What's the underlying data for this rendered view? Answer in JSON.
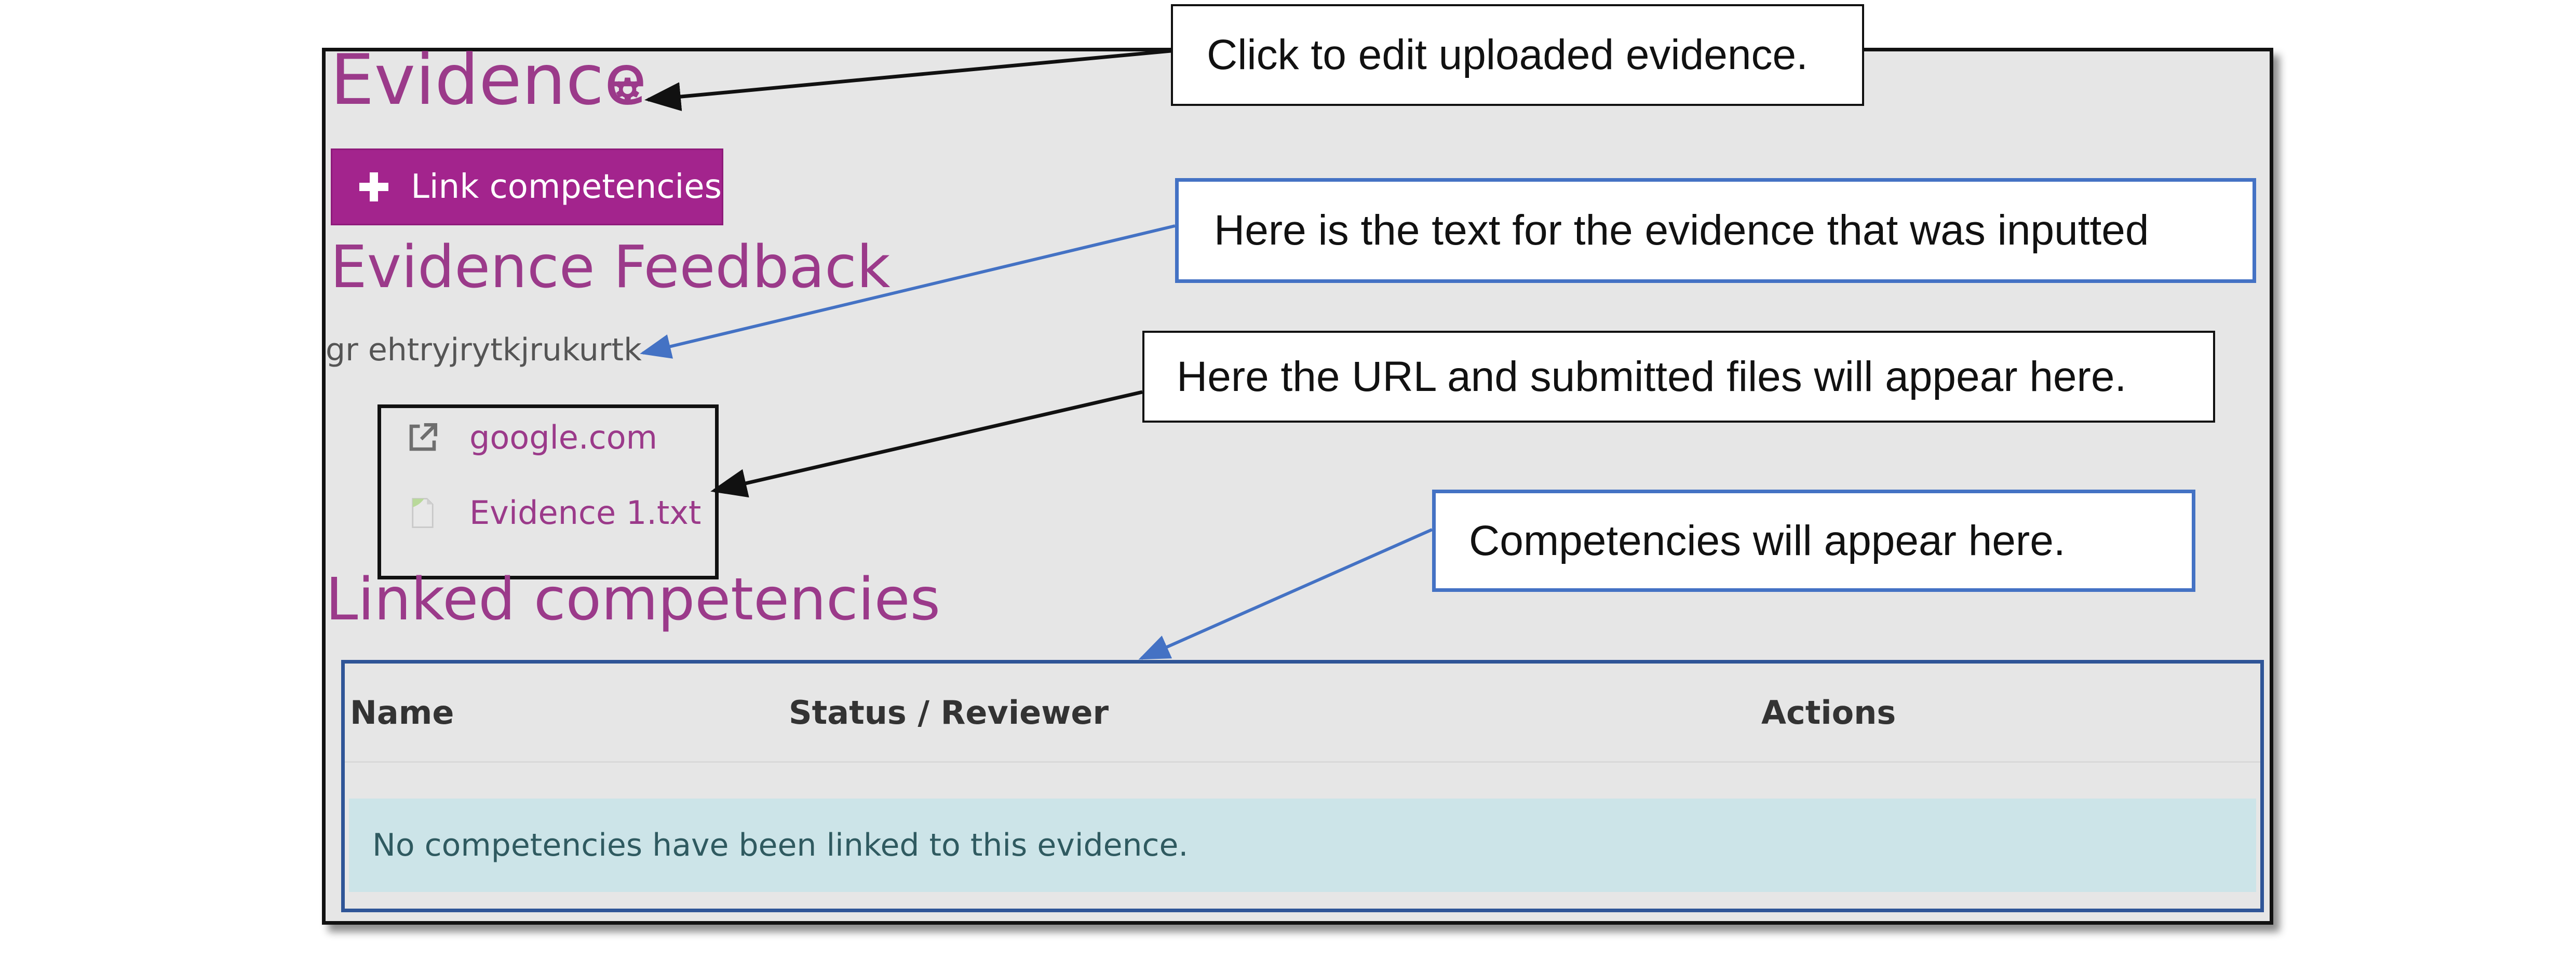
{
  "page": {
    "title": "Evidence",
    "link_button_label": "Link competencies",
    "feedback_title": "Evidence Feedback",
    "feedback_text": "gr ehtryjrytkjrukurtk",
    "files": [
      {
        "label": "google.com",
        "icon": "external-link-icon"
      },
      {
        "label": "Evidence 1.txt",
        "icon": "text-file-icon"
      }
    ],
    "linked_title": "Linked competencies",
    "table": {
      "headers": [
        "Name",
        "Status / Reviewer",
        "Actions"
      ],
      "empty_message": "No competencies have been linked to this evidence."
    }
  },
  "callouts": {
    "edit": "Click to edit uploaded evidence.",
    "text": "Here is the text for the evidence that was inputted",
    "files": "Here the URL and submitted files will appear here.",
    "competencies": "Competencies will appear here."
  },
  "colors": {
    "accent": "#9b3a8a",
    "button": "#a3248d",
    "panel_bg": "#e6e6e6",
    "info_row": "#cce4e8",
    "callout_blue": "#4472c4"
  }
}
